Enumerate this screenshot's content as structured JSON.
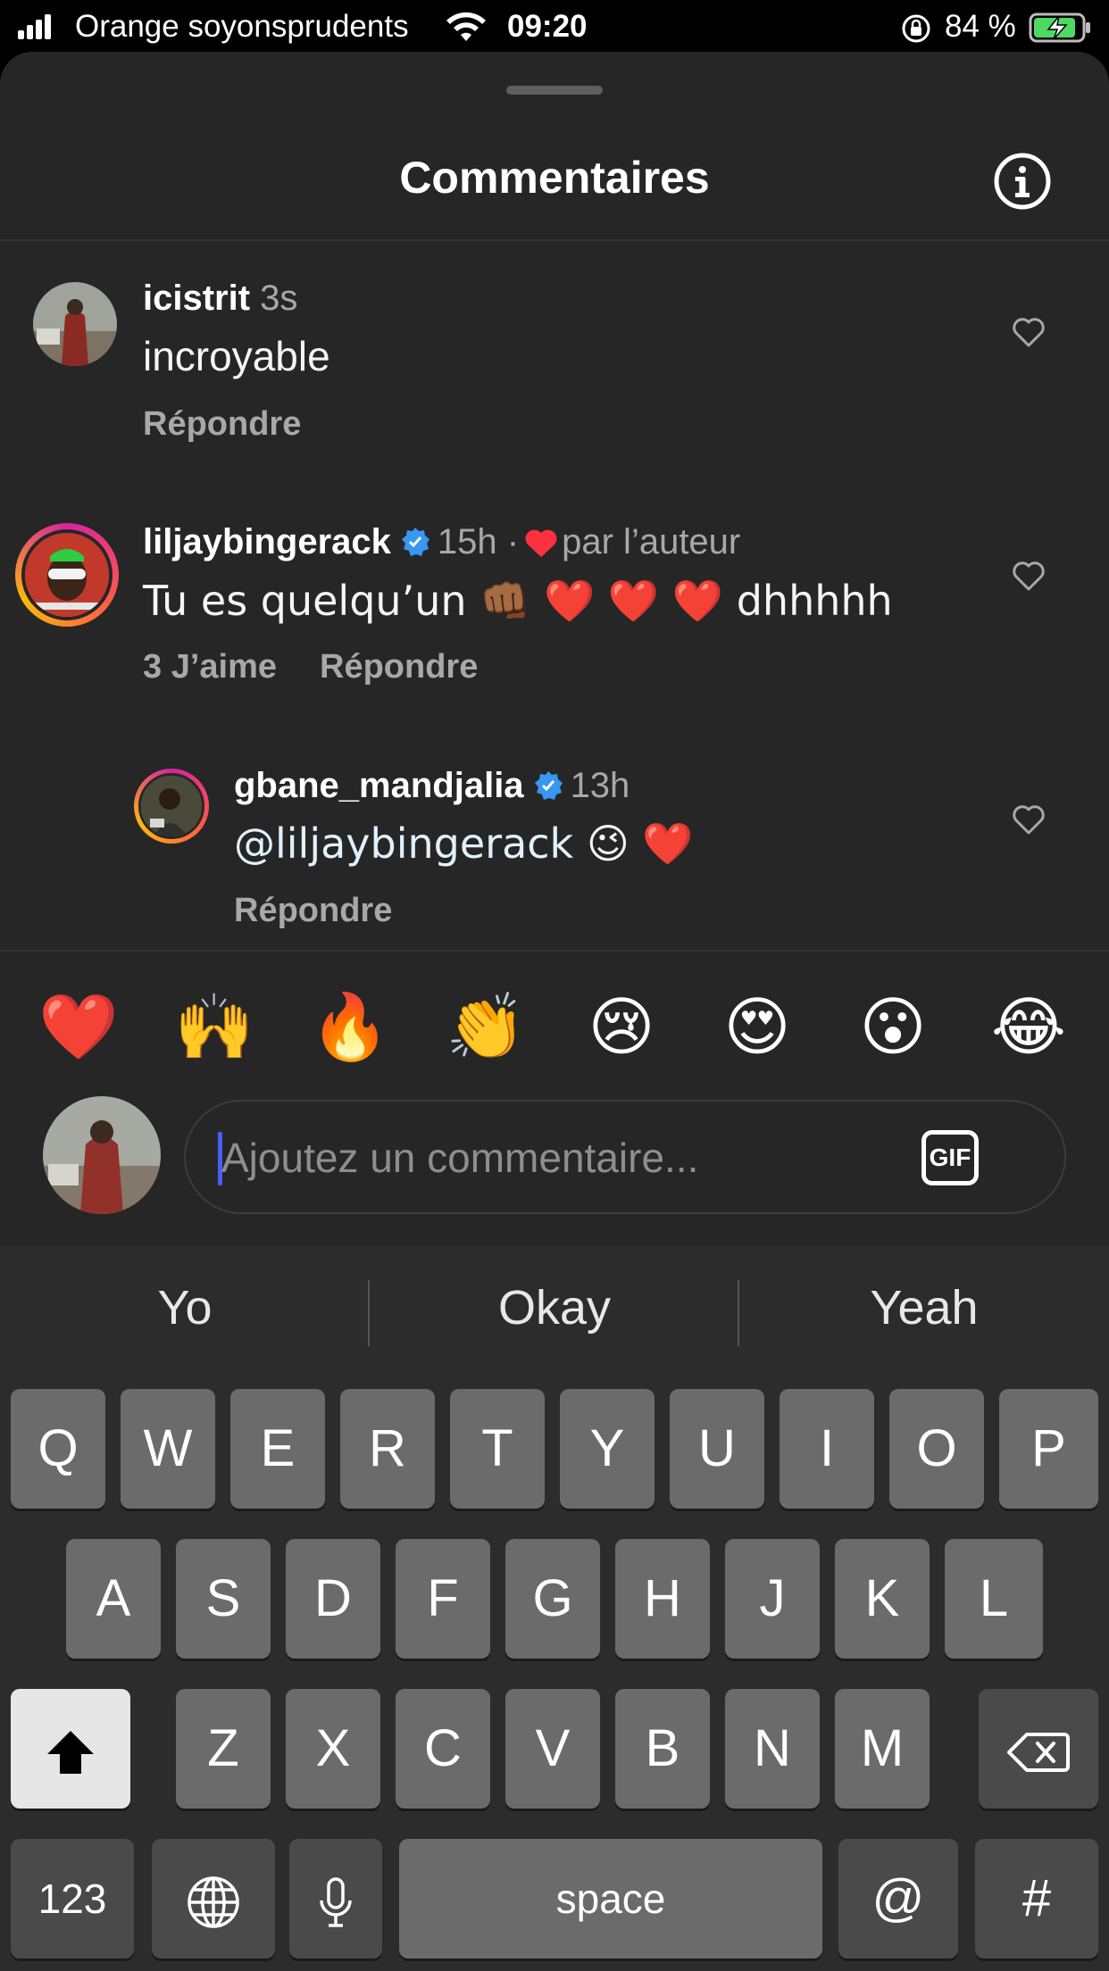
{
  "status_bar": {
    "carrier": "Orange soyonsprudents",
    "time": "09:20",
    "battery": "84 %"
  },
  "sheet": {
    "title": "Commentaires"
  },
  "comments": [
    {
      "username": "icistrit",
      "time": "3s",
      "text": "incroyable",
      "reply_label": "Répondre"
    },
    {
      "username": "liljaybingerack",
      "verified": true,
      "time": "15h",
      "separator": "·",
      "liked_by_author": "par l’auteur",
      "text": "Tu es quelqu’un 👊🏾 ❤️ ❤️ ❤️ dhhhhh",
      "likes_label": "3 J’aime",
      "reply_label": "Répondre"
    },
    {
      "username": "gbane_mandjalia",
      "verified": true,
      "time": "13h",
      "mention": "@liljaybingerack",
      "text_after_mention": " 😉 ❤️",
      "reply_label": "Répondre"
    }
  ],
  "reactions": [
    "❤️",
    "🙌",
    "🔥",
    "👏",
    "😢",
    "😍",
    "😮",
    "😂"
  ],
  "comment_input": {
    "placeholder": "Ajoutez un commentaire...",
    "gif_label": "GIF"
  },
  "keyboard": {
    "suggestions": [
      "Yo",
      "Okay",
      "Yeah"
    ],
    "row1": [
      "Q",
      "W",
      "E",
      "R",
      "T",
      "Y",
      "U",
      "I",
      "O",
      "P"
    ],
    "row2": [
      "A",
      "S",
      "D",
      "F",
      "G",
      "H",
      "J",
      "K",
      "L"
    ],
    "row3": [
      "Z",
      "X",
      "C",
      "V",
      "B",
      "N",
      "M"
    ],
    "numbers_label": "123",
    "space_label": "space",
    "at_label": "@",
    "hash_label": "#"
  },
  "colors": {
    "sheet_bg": "#262626",
    "keyboard_bg": "#2c2c2c",
    "verified": "#3897f0",
    "heart": "#ff3040",
    "cursor": "#4c5bff"
  }
}
